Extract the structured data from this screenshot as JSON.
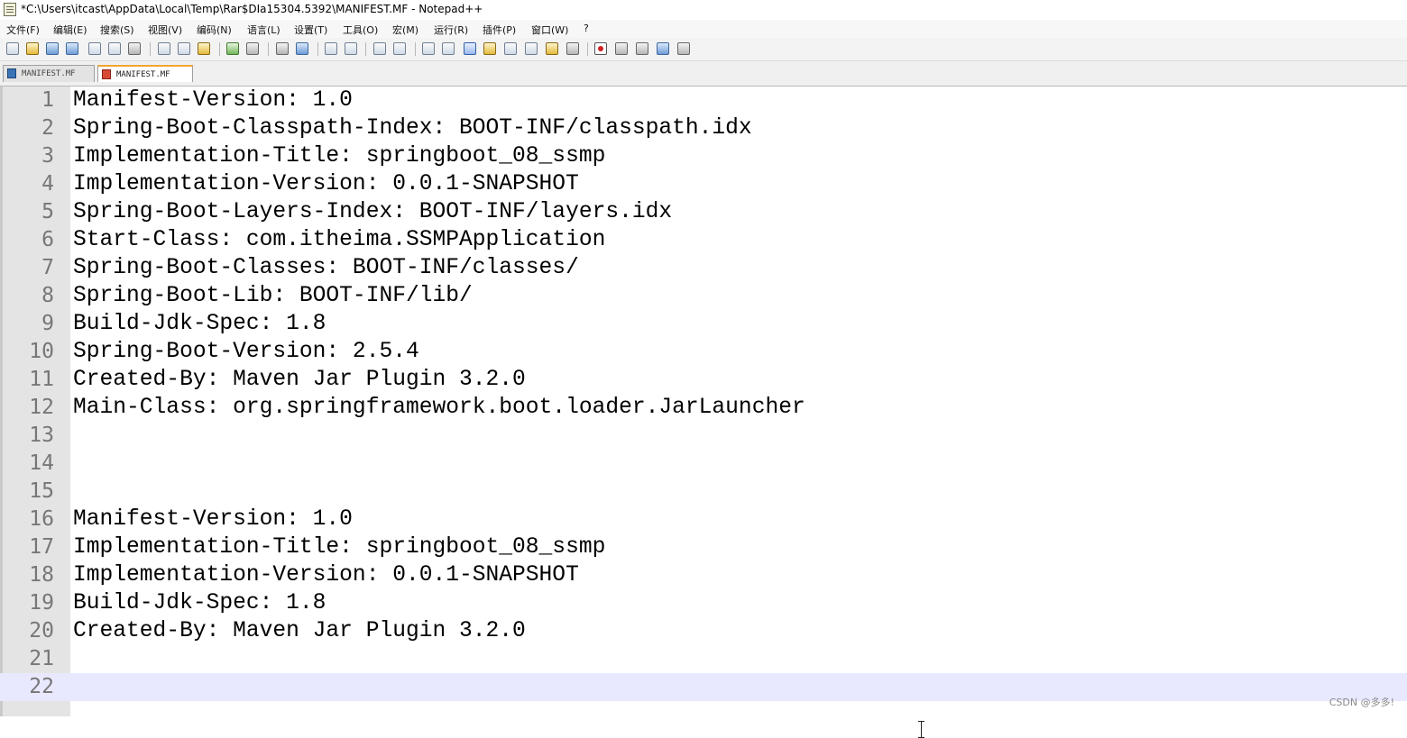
{
  "window": {
    "title": "*C:\\Users\\itcast\\AppData\\Local\\Temp\\Rar$DIa15304.5392\\MANIFEST.MF - Notepad++"
  },
  "menu": [
    "文件(F)",
    "编辑(E)",
    "搜索(S)",
    "视图(V)",
    "编码(N)",
    "语言(L)",
    "设置(T)",
    "工具(O)",
    "宏(M)",
    "运行(R)",
    "插件(P)",
    "窗口(W)",
    "?"
  ],
  "toolbar_icons": [
    "new-file-icon",
    "open-file-icon",
    "save-icon",
    "save-all-icon",
    "close-icon",
    "close-all-icon",
    "print-icon",
    "cut-icon",
    "copy-icon",
    "paste-icon",
    "undo-icon",
    "redo-icon",
    "find-icon",
    "replace-icon",
    "zoom-in-icon",
    "zoom-out-icon",
    "sync-vertical-icon",
    "sync-horizontal-icon",
    "word-wrap-icon",
    "show-all-chars-icon",
    "indent-guide-icon",
    "user-language-icon",
    "document-map-icon",
    "function-list-icon",
    "folder-workspace-icon",
    "monitoring-icon",
    "record-macro-icon",
    "stop-macro-icon",
    "play-macro-icon",
    "run-macro-multiple-icon",
    "save-macro-icon"
  ],
  "tabs": [
    {
      "label": "MANIFEST.MF",
      "active": false
    },
    {
      "label": "MANIFEST.MF",
      "active": true
    }
  ],
  "editor": {
    "current_line": 22,
    "lines": [
      {
        "num": "1",
        "text": "Manifest-Version: 1.0"
      },
      {
        "num": "2",
        "text": "Spring-Boot-Classpath-Index: BOOT-INF/classpath.idx"
      },
      {
        "num": "3",
        "text": "Implementation-Title: springboot_08_ssmp"
      },
      {
        "num": "4",
        "text": "Implementation-Version: 0.0.1-SNAPSHOT"
      },
      {
        "num": "5",
        "text": "Spring-Boot-Layers-Index: BOOT-INF/layers.idx"
      },
      {
        "num": "6",
        "text": "Start-Class: com.itheima.SSMPApplication"
      },
      {
        "num": "7",
        "text": "Spring-Boot-Classes: BOOT-INF/classes/"
      },
      {
        "num": "8",
        "text": "Spring-Boot-Lib: BOOT-INF/lib/"
      },
      {
        "num": "9",
        "text": "Build-Jdk-Spec: 1.8"
      },
      {
        "num": "10",
        "text": "Spring-Boot-Version: 2.5.4"
      },
      {
        "num": "11",
        "text": "Created-By: Maven Jar Plugin 3.2.0"
      },
      {
        "num": "12",
        "text": "Main-Class: org.springframework.boot.loader.JarLauncher"
      },
      {
        "num": "13",
        "text": ""
      },
      {
        "num": "14",
        "text": ""
      },
      {
        "num": "15",
        "text": ""
      },
      {
        "num": "16",
        "text": "Manifest-Version: 1.0"
      },
      {
        "num": "17",
        "text": "Implementation-Title: springboot_08_ssmp"
      },
      {
        "num": "18",
        "text": "Implementation-Version: 0.0.1-SNAPSHOT"
      },
      {
        "num": "19",
        "text": "Build-Jdk-Spec: 1.8"
      },
      {
        "num": "20",
        "text": "Created-By: Maven Jar Plugin 3.2.0"
      },
      {
        "num": "21",
        "text": ""
      },
      {
        "num": "22",
        "text": ""
      }
    ]
  },
  "watermark": "CSDN @多多!"
}
